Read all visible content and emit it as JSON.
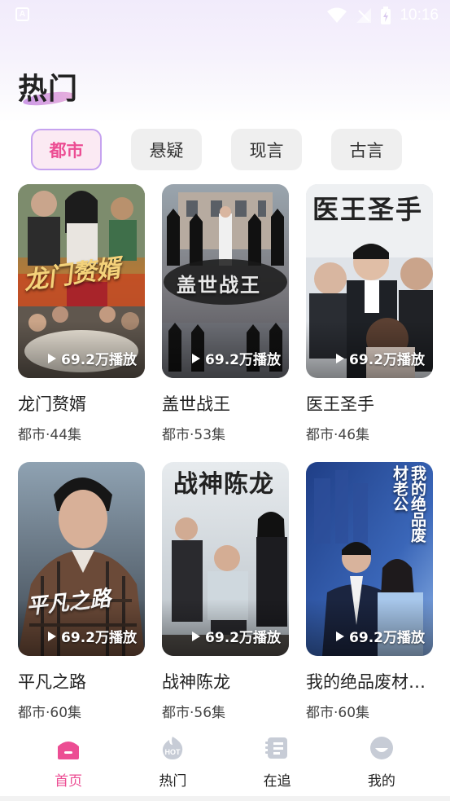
{
  "status_bar": {
    "time": "10:16",
    "left_icon": "A"
  },
  "page": {
    "title": "热门"
  },
  "tabs": [
    {
      "label": "都市",
      "active": true
    },
    {
      "label": "悬疑",
      "active": false
    },
    {
      "label": "现言",
      "active": false
    },
    {
      "label": "古言",
      "active": false
    }
  ],
  "dramas": [
    {
      "title": "龙门赘婿",
      "meta": "都市·44集",
      "plays": "69.2万播放",
      "poster_text": "龙门赘婿"
    },
    {
      "title": "盖世战王",
      "meta": "都市·53集",
      "plays": "69.2万播放",
      "poster_text": "盖世战王"
    },
    {
      "title": "医王圣手",
      "meta": "都市·46集",
      "plays": "69.2万播放",
      "poster_text": "医王圣手"
    },
    {
      "title": "平凡之路",
      "meta": "都市·60集",
      "plays": "69.2万播放",
      "poster_text": "平凡之路"
    },
    {
      "title": "战神陈龙",
      "meta": "都市·56集",
      "plays": "69.2万播放",
      "poster_text": "战神陈龙"
    },
    {
      "title": "我的绝品废材老公",
      "meta": "都市·60集",
      "plays": "69.2万播放",
      "poster_text": "我的绝品废材老公"
    }
  ],
  "bottom_nav": [
    {
      "label": "首页",
      "icon": "home-icon",
      "active": true
    },
    {
      "label": "热门",
      "icon": "hot-icon",
      "active": false
    },
    {
      "label": "在追",
      "icon": "drama-icon",
      "active": false
    },
    {
      "label": "我的",
      "icon": "profile-icon",
      "active": false
    }
  ],
  "colors": {
    "accent": "#ec4d93",
    "tab_border": "#c6a3ef",
    "tab_bg": "#efefef"
  }
}
